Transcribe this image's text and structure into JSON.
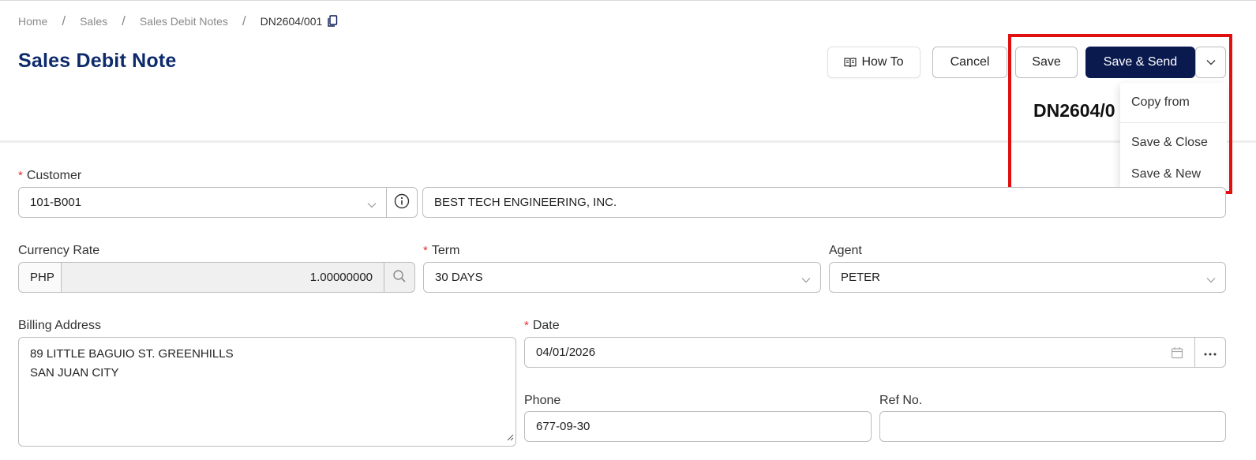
{
  "breadcrumb": {
    "items": [
      "Home",
      "Sales",
      "Sales Debit Notes"
    ],
    "separator": "/",
    "current": "DN2604/001"
  },
  "page": {
    "title": "Sales Debit Note"
  },
  "toolbar": {
    "how_to_label": "How To",
    "cancel_label": "Cancel",
    "save_label": "Save",
    "save_send_label": "Save & Send"
  },
  "document": {
    "number_partial": "DN2604/0"
  },
  "dropdown_menu": {
    "items": [
      "Copy from",
      "Save & Close",
      "Save & New"
    ]
  },
  "form": {
    "customer": {
      "label": "Customer",
      "code": "101-B001",
      "name": "BEST TECH ENGINEERING, INC."
    },
    "currency_rate": {
      "label": "Currency Rate",
      "currency": "PHP",
      "rate": "1.00000000"
    },
    "term": {
      "label": "Term",
      "value": "30 DAYS"
    },
    "agent": {
      "label": "Agent",
      "value": "PETER"
    },
    "billing_address": {
      "label": "Billing Address",
      "line1": "89 LITTLE BAGUIO ST. GREENHILLS",
      "line2": "SAN JUAN CITY"
    },
    "date": {
      "label": "Date",
      "value": "04/01/2026"
    },
    "phone": {
      "label": "Phone",
      "value": "677-09-30"
    },
    "ref_no": {
      "label": "Ref No.",
      "value": ""
    }
  },
  "colors": {
    "primary": "#0a1a4f",
    "title": "#0d2a6b",
    "required": "#e03030",
    "highlight": "#e01010"
  }
}
